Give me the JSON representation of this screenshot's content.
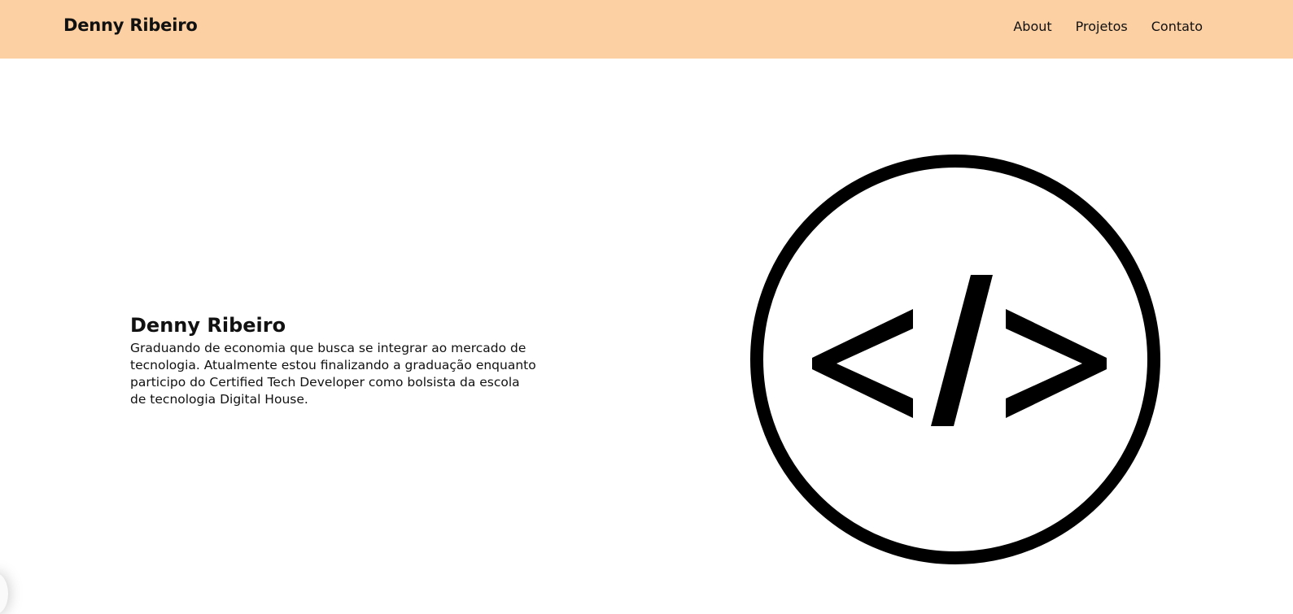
{
  "header": {
    "brand": "Denny Ribeiro",
    "nav": [
      {
        "label": "About"
      },
      {
        "label": "Projetos"
      },
      {
        "label": "Contato"
      }
    ],
    "background_color": "#fcd0a3"
  },
  "hero": {
    "title": "Denny Ribeiro",
    "description": "Graduando de economia que busca se integrar ao mercado de tecnologia. Atualmente estou finalizando a graduação enquanto participo do Certified Tech Developer como bolsista da escola de tecnologia Digital House.",
    "logo_icon": "code-brackets-icon"
  }
}
